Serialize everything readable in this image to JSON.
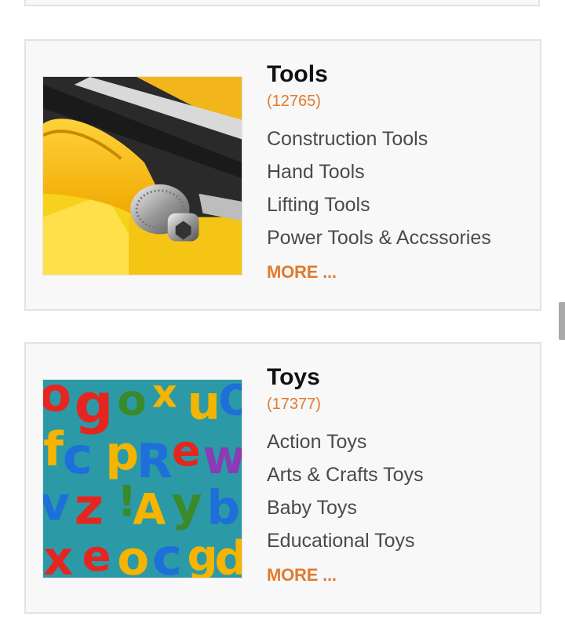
{
  "categories": [
    {
      "title": "Tools",
      "count": "(12765)",
      "image_icon": "screwdriver-bits-photo",
      "subcategories": [
        "Construction Tools",
        "Hand Tools",
        "Lifting Tools",
        "Power Tools & Accssories"
      ],
      "more_label": "MORE ..."
    },
    {
      "title": "Toys",
      "count": "(17377)",
      "image_icon": "alphabet-letters-photo",
      "subcategories": [
        "Action Toys",
        "Arts & Crafts Toys",
        "Baby Toys",
        "Educational Toys"
      ],
      "more_label": "MORE ..."
    }
  ],
  "colors": {
    "accent": "#e07a2e",
    "card_bg": "#f8f8f8",
    "card_border": "#e3e3e3",
    "text": "#4a4a4a",
    "title": "#111111"
  }
}
